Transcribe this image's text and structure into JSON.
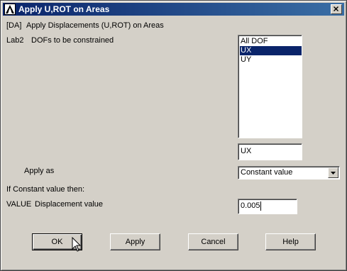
{
  "window": {
    "title": "Apply U,ROT on Areas",
    "close_glyph": "X",
    "app_icon": "ansys-logo-icon"
  },
  "header": {
    "tag": "[DA]",
    "description": "Apply Displacements (U,ROT) on Areas"
  },
  "lab2": {
    "tag": "Lab2",
    "label": "DOFs to be constrained",
    "options": [
      "All DOF",
      "UX",
      "UY"
    ],
    "selected_index": 1,
    "selected_value": "UX"
  },
  "apply_as": {
    "label": "Apply as",
    "value": "Constant value"
  },
  "constant_note": "If Constant value then:",
  "value_field": {
    "tag": "VALUE",
    "label": "Displacement value",
    "value": "0.005"
  },
  "buttons": {
    "ok": "OK",
    "apply": "Apply",
    "cancel": "Cancel",
    "help": "Help"
  },
  "colors": {
    "titlebar": "#0a246a",
    "selection": "#0a246a",
    "dialog_bg": "#d4d0c8"
  }
}
